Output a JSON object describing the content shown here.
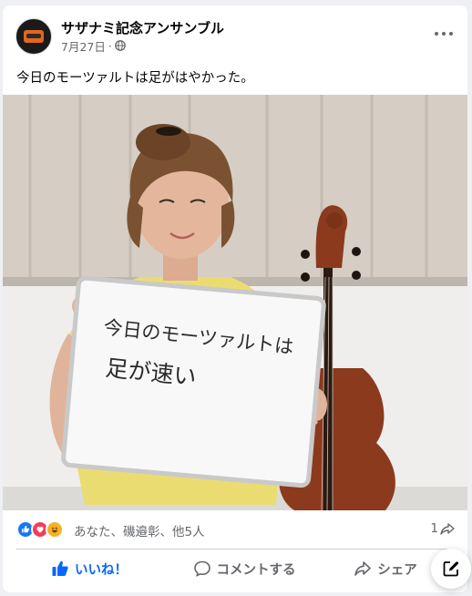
{
  "post": {
    "page_name": "サザナミ記念アンサンブル",
    "date": "7月27日",
    "separator": "·",
    "privacy_icon": "globe-icon",
    "text": "今日のモーツァルトは足がはやかった。"
  },
  "photo": {
    "whiteboard_lines": [
      "今日のモーツァルトは",
      "足が速い"
    ]
  },
  "engagement": {
    "reaction_icons": [
      "like",
      "love",
      "haha"
    ],
    "reactors": "あなた、磯邉彰、他5人",
    "share_count": "1"
  },
  "actions": {
    "like_label": "いいね！",
    "comment_label": "コメントする",
    "share_label": "シェア"
  },
  "colors": {
    "accent": "#0866ff",
    "text_secondary": "#65676b",
    "like_reaction": "#1877f2",
    "love_reaction": "#f33e58",
    "haha_reaction": "#f7b125"
  }
}
